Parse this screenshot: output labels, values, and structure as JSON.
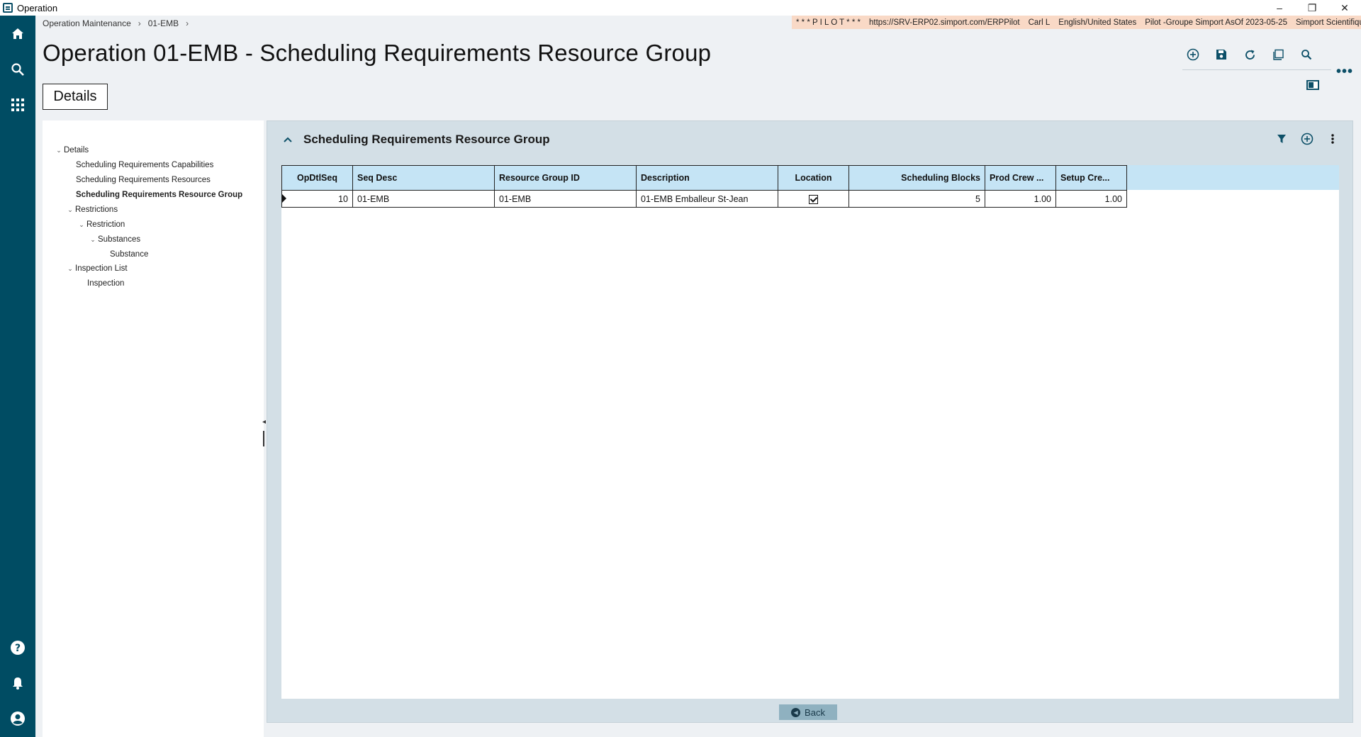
{
  "window": {
    "title": "Operation",
    "controls": {
      "minimize": "–",
      "restore": "❐",
      "close": "✕"
    }
  },
  "rail": {
    "top_icons": [
      "home-icon",
      "search-icon",
      "apps-grid-icon"
    ],
    "bottom_icons": [
      "help-icon",
      "bell-icon",
      "user-icon"
    ]
  },
  "breadcrumb": [
    "Operation Maintenance",
    "01-EMB"
  ],
  "environment": {
    "pilot": "* * * P I L O T * * *",
    "url": "https://SRV-ERP02.simport.com/ERPPilot",
    "user": "Carl L",
    "language": "English/United States",
    "company": "Pilot -Groupe Simport AsOf 2023-05-25",
    "site": "Simport Scientifique Inc."
  },
  "page": {
    "title": "Operation 01-EMB - Scheduling Requirements Resource Group"
  },
  "tabs": {
    "details": "Details"
  },
  "tree": [
    {
      "label": "Details",
      "level": 0,
      "expanded": true
    },
    {
      "label": "Scheduling Requirements Capabilities",
      "level": 1
    },
    {
      "label": "Scheduling Requirements Resources",
      "level": 1
    },
    {
      "label": "Scheduling Requirements Resource Group",
      "level": 1,
      "active": true
    },
    {
      "label": "Restrictions",
      "level": 1,
      "expanded": true
    },
    {
      "label": "Restriction",
      "level": 2,
      "expanded": true
    },
    {
      "label": "Substances",
      "level": 3,
      "expanded": true
    },
    {
      "label": "Substance",
      "level": 4
    },
    {
      "label": "Inspection List",
      "level": 1,
      "expanded": true
    },
    {
      "label": "Inspection",
      "level": 2
    }
  ],
  "panel": {
    "title": "Scheduling Requirements Resource Group",
    "columns": [
      "OpDtlSeq",
      "Seq Desc",
      "Resource Group ID",
      "Description",
      "Location",
      "Scheduling Blocks",
      "Prod Crew ...",
      "Setup Cre..."
    ],
    "rows": [
      {
        "opdtlseq": "10",
        "seq_desc": "01-EMB",
        "resource_group_id": "01-EMB",
        "description": "01-EMB Emballeur St-Jean",
        "location": true,
        "scheduling_blocks": "5",
        "prod_crew": "1.00",
        "setup_crew": "1.00"
      }
    ]
  },
  "footer": {
    "back": "Back"
  }
}
